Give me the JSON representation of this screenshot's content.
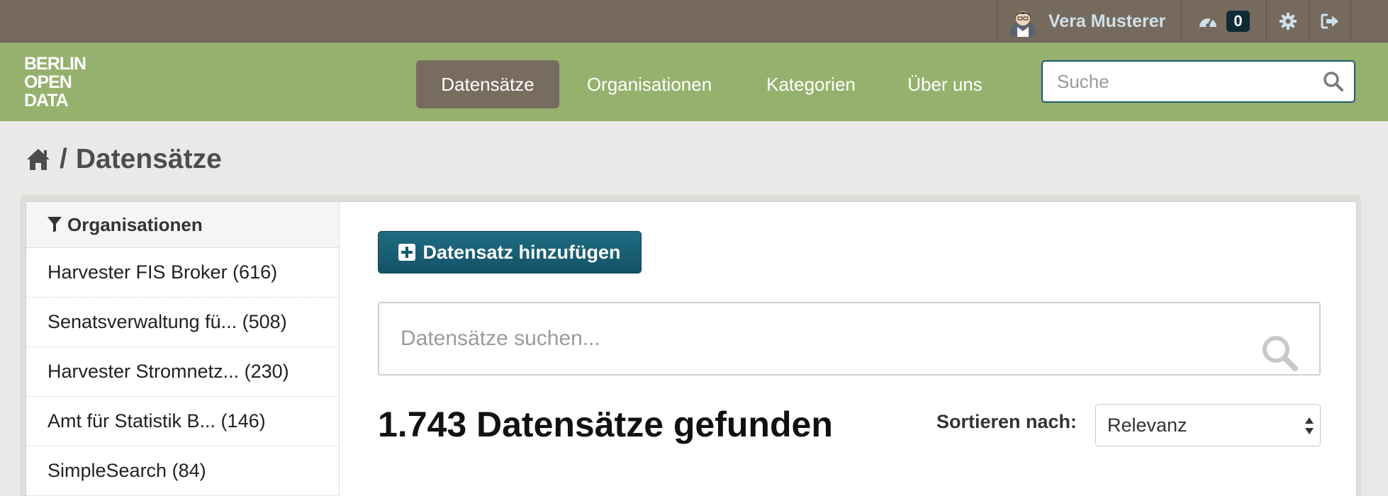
{
  "account": {
    "user_name": "Vera Musterer",
    "dashboard_count": "0"
  },
  "nav": {
    "items": [
      {
        "label": "Datensätze",
        "active": true
      },
      {
        "label": "Organisationen",
        "active": false
      },
      {
        "label": "Kategorien",
        "active": false
      },
      {
        "label": "Über uns",
        "active": false
      }
    ],
    "search_placeholder": "Suche"
  },
  "logo": {
    "lines": [
      "BERLIN",
      "OPEN",
      "DATA"
    ]
  },
  "breadcrumb": {
    "separator": "/",
    "current": "Datensätze"
  },
  "sidebar": {
    "heading": "Organisationen",
    "facets": [
      "Harvester FIS Broker (616)",
      "Senatsverwaltung fü... (508)",
      "Harvester Stromnetz... (230)",
      "Amt für Statistik B... (146)",
      "SimpleSearch (84)"
    ]
  },
  "main": {
    "add_button_label": "Datensatz hinzufügen",
    "search_placeholder": "Datensätze suchen...",
    "results_text": "1.743 Datensätze gefunden",
    "sort_label": "Sortieren nach:",
    "sort_value": "Relevanz"
  },
  "colors": {
    "account_bar": "#766a5e",
    "masthead": "#96b16d",
    "nav_active": "#786b5f",
    "primary_button": "#1a6074",
    "badge": "#0e2b36"
  },
  "icons": [
    "avatar-icon",
    "dashboard-icon",
    "gear-icon",
    "logout-icon",
    "search-icon",
    "home-icon",
    "filter-icon",
    "plus-square-icon",
    "select-arrows-icon"
  ]
}
